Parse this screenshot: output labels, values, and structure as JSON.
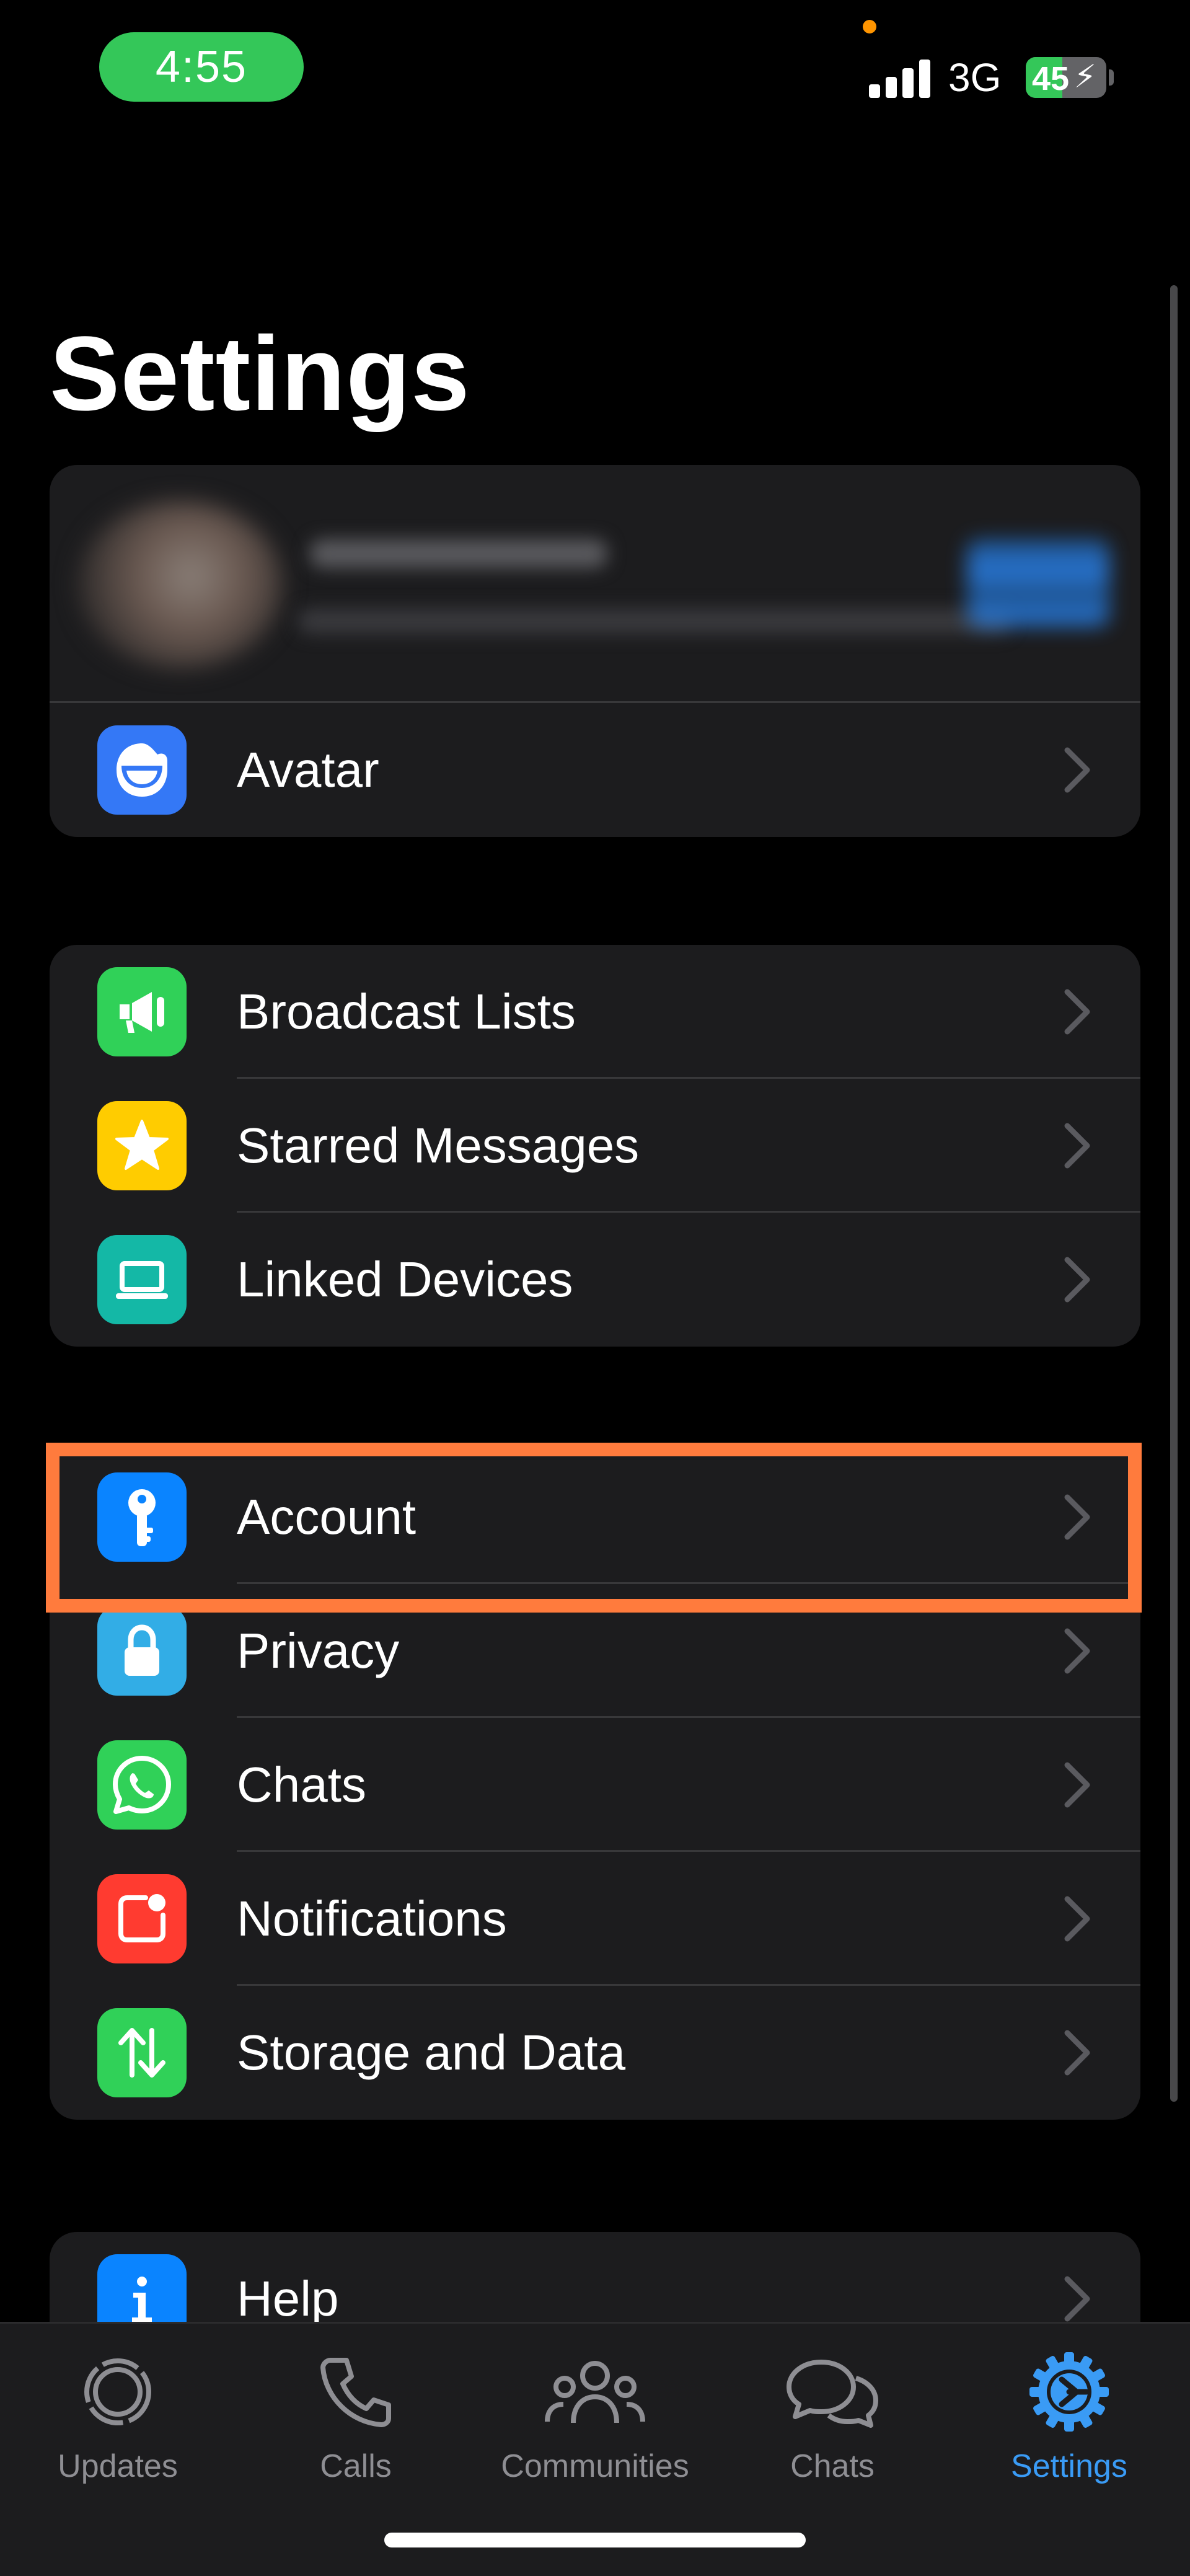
{
  "status_bar": {
    "time": "4:55",
    "network": "3G",
    "battery_level": "45",
    "charging_icon": "bolt-icon"
  },
  "title": "Settings",
  "profile_group": {
    "items": [
      {
        "label": "Avatar",
        "icon": "avatar-icon",
        "color": "#3478f6"
      }
    ]
  },
  "tools_group": {
    "items": [
      {
        "label": "Broadcast Lists",
        "icon": "megaphone-icon",
        "color": "#30d158"
      },
      {
        "label": "Starred Messages",
        "icon": "star-icon",
        "color": "#ffcc00"
      },
      {
        "label": "Linked Devices",
        "icon": "laptop-icon",
        "color": "#14b8a6"
      }
    ]
  },
  "main_group": {
    "items": [
      {
        "label": "Account",
        "icon": "key-icon",
        "color": "#0a84ff"
      },
      {
        "label": "Privacy",
        "icon": "lock-icon",
        "color": "#32ade6"
      },
      {
        "label": "Chats",
        "icon": "whatsapp-icon",
        "color": "#30d158"
      },
      {
        "label": "Notifications",
        "icon": "notification-badge-icon",
        "color": "#ff3b30"
      },
      {
        "label": "Storage and Data",
        "icon": "up-down-arrows-icon",
        "color": "#30d158"
      }
    ]
  },
  "help_group": {
    "items": [
      {
        "label": "Help",
        "icon": "info-icon",
        "color": "#0a84ff"
      }
    ]
  },
  "tab_bar": {
    "tabs": [
      {
        "label": "Updates",
        "icon": "updates-icon",
        "active": false
      },
      {
        "label": "Calls",
        "icon": "phone-icon",
        "active": false
      },
      {
        "label": "Communities",
        "icon": "communities-icon",
        "active": false
      },
      {
        "label": "Chats",
        "icon": "chat-bubbles-icon",
        "active": false
      },
      {
        "label": "Settings",
        "icon": "settings-gear-icon",
        "active": true
      }
    ],
    "active_color": "#3a9bf5",
    "inactive_color": "#8e8e93"
  },
  "highlight_color": "#ff7b3d"
}
